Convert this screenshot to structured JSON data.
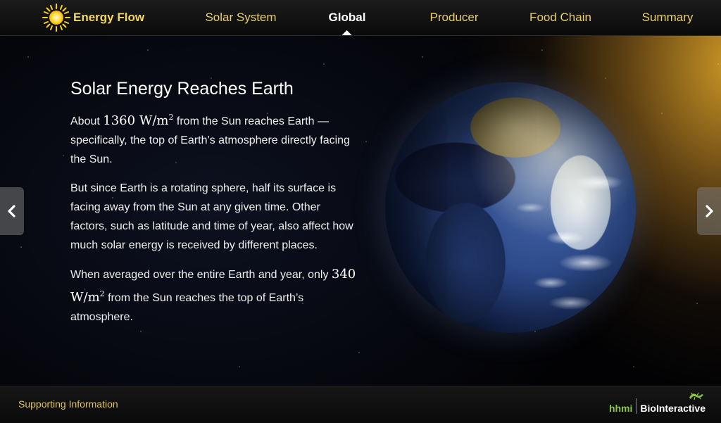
{
  "header": {
    "app_title": "Energy Flow",
    "nav": [
      {
        "label": "Solar System",
        "active": false
      },
      {
        "label": "Global",
        "active": true
      },
      {
        "label": "Producer",
        "active": false
      },
      {
        "label": "Food Chain",
        "active": false
      },
      {
        "label": "Summary",
        "active": false
      }
    ]
  },
  "slide": {
    "title": "Solar Energy Reaches Earth",
    "para1": {
      "prefix": "About ",
      "value": "1360",
      "unit": "W/m",
      "exp": "2",
      "suffix": " from the Sun reaches Earth —specifically, the top of Earth’s atmosphere directly facing the Sun."
    },
    "para2": "But since Earth is a rotating sphere, half its surface is facing away from the Sun at any given time. Other factors, such as latitude and time of year, also affect how much solar energy is received by different places.",
    "para3": {
      "prefix": "When averaged over the entire Earth and year, only ",
      "value": "340",
      "unit": "W/m",
      "exp": "2",
      "suffix": " from the Sun reaches the top of Earth’s atmosphere."
    }
  },
  "icons": {
    "logo": "sun-icon",
    "prev": "chevron-left-icon",
    "next": "chevron-right-icon",
    "brand_mark": "lizard-icon"
  },
  "footer": {
    "supporting_info": "Supporting Information",
    "brand_hhmi": "hhmi",
    "brand_name": "BioInteractive"
  },
  "colors": {
    "nav_text": "#e9cf6a",
    "nav_active": "#ffffff",
    "hhmi_green": "#8cc63e"
  }
}
